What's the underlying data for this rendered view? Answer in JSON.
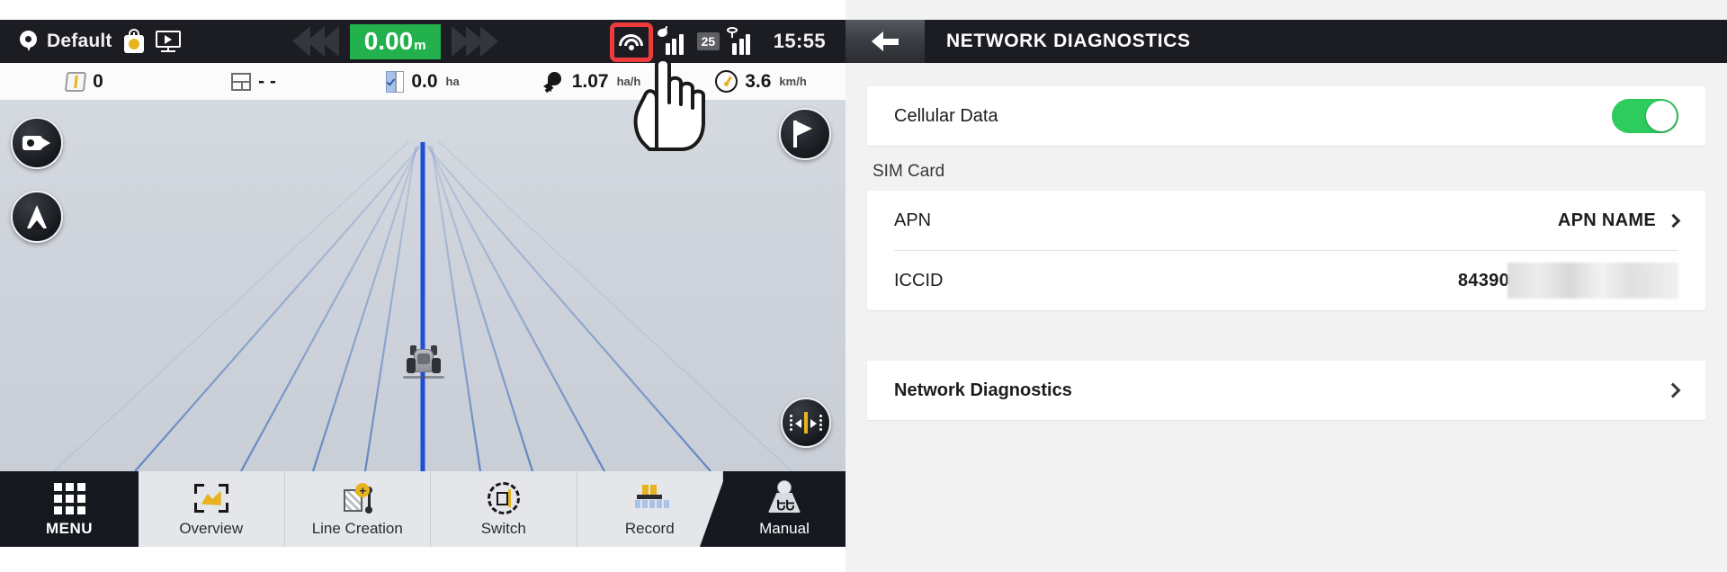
{
  "left_terminal": {
    "status_bar": {
      "profile_name": "Default",
      "location_icon": "location-pin-icon",
      "implement_icon": "implement-icon",
      "display_icon": "display-screen-icon",
      "offset_value": "0.00",
      "offset_unit": "m",
      "offset_color": "#22b14c",
      "wifi_icon": "wifi-icon",
      "wifi_highlight_color": "#ef3b3b",
      "gps_signal_icon": "gps-satellite-signal-icon",
      "gps_satellite_count": "25",
      "cellular_signal_icon": "cellular-signal-icon",
      "clock": "15:55"
    },
    "info_row": [
      {
        "icon": "field-boundary-icon",
        "value": "0",
        "unit": ""
      },
      {
        "icon": "grid-layout-icon",
        "value": "- -",
        "unit": ""
      },
      {
        "icon": "coverage-check-icon",
        "value": "0.0",
        "unit": "ha"
      },
      {
        "icon": "rocket-productivity-icon",
        "value": "1.07",
        "unit": "ha/h"
      },
      {
        "icon": "speedometer-icon",
        "value": "3.6",
        "unit": "km/h"
      }
    ],
    "map_buttons": [
      {
        "name": "camera-view-button",
        "icon": "camera-icon"
      },
      {
        "name": "north-orientation-button",
        "icon": "navigation-arrow-icon"
      },
      {
        "name": "flag-marker-button",
        "icon": "flag-icon"
      },
      {
        "name": "lightbar-button",
        "icon": "lightbar-icon"
      }
    ],
    "vehicle_icon": "tractor-icon",
    "cursor_icon": "hand-pointer-cursor",
    "bottom_nav": [
      {
        "label": "MENU",
        "icon": "grid-menu-icon",
        "active": true
      },
      {
        "label": "Overview",
        "icon": "overview-chart-icon",
        "active": false
      },
      {
        "label": "Line Creation",
        "icon": "line-creation-icon",
        "active": false
      },
      {
        "label": "Switch",
        "icon": "switch-rotate-icon",
        "active": false
      },
      {
        "label": "Record",
        "icon": "record-implement-icon",
        "active": false
      },
      {
        "label": "Manual",
        "icon": "manual-gear-shift-icon",
        "active": true
      }
    ]
  },
  "right_settings": {
    "header": {
      "back_icon": "back-arrow-icon",
      "title": "NETWORK DIAGNOSTICS"
    },
    "cellular": {
      "label": "Cellular Data",
      "toggle_state": "on",
      "toggle_color": "#2ecc5e"
    },
    "sim_section": {
      "section_label": "SIM Card",
      "rows": [
        {
          "label": "APN",
          "value": "APN NAME",
          "chevron": "chevron-right-icon",
          "redacted": false
        },
        {
          "label": "ICCID",
          "value": "84390",
          "chevron": "",
          "redacted": true
        }
      ]
    },
    "diagnostics_row": {
      "label": "Network Diagnostics",
      "chevron": "chevron-right-icon"
    }
  }
}
